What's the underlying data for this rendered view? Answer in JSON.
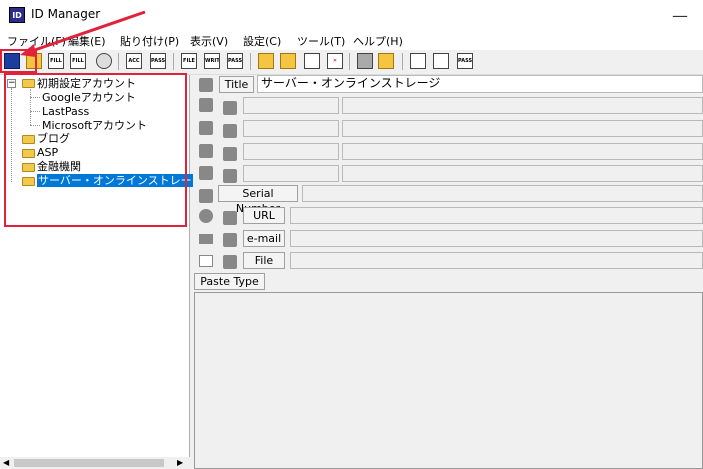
{
  "window": {
    "title": "ID Manager",
    "app_icon_text": "ID"
  },
  "menu": [
    "ファイル(F)",
    "編集(E)",
    "貼り付け(P)",
    "表示(V)",
    "設定(C)",
    "ツール(T)",
    "ヘルプ(H)"
  ],
  "toolbar": [
    {
      "name": "save-icon",
      "text": ""
    },
    {
      "name": "folder-open-icon",
      "text": ""
    },
    {
      "name": "fill-icon",
      "text": "FILL"
    },
    {
      "name": "fill-icon-2",
      "text": "FILL"
    },
    {
      "name": "pass-lock-icon",
      "text": ""
    },
    {
      "name": "printer-icon",
      "text": ""
    },
    {
      "name": "acc-icon",
      "text": "ACC"
    },
    {
      "name": "pass-icon",
      "text": "PASS"
    },
    {
      "name": "file-icon",
      "text": "FILE"
    },
    {
      "name": "write-icon",
      "text": "WRITE"
    },
    {
      "name": "pass-write-icon",
      "text": "PASS"
    },
    {
      "name": "new-folder-icon",
      "text": ""
    },
    {
      "name": "folder-add-icon",
      "text": ""
    },
    {
      "name": "new-document-icon",
      "text": ""
    },
    {
      "name": "delete-icon",
      "text": ""
    },
    {
      "name": "mp-icon",
      "text": ""
    },
    {
      "name": "swap-icon",
      "text": ""
    },
    {
      "name": "window-up-icon",
      "text": ""
    },
    {
      "name": "window-edit-icon",
      "text": ""
    },
    {
      "name": "pass-window-icon",
      "text": "PASS"
    }
  ],
  "tree": {
    "root": "初期設定アカウント",
    "children": [
      "Googleアカウント",
      "LastPass",
      "Microsoftアカウント"
    ],
    "folders": [
      "ブログ",
      "ASP",
      "金融機関",
      "サーバー・オンラインストレー"
    ],
    "selected": "サーバー・オンラインストレー"
  },
  "fields": {
    "title_label": "Title",
    "title_value": "サーバー・オンラインストレージ",
    "serial_label": "Serial Number",
    "url_label": "URL",
    "email_label": "e-mail",
    "file_label": "File",
    "paste_type_label": "Paste Type"
  },
  "colors": {
    "selection": "#0078d7",
    "annotation": "#e0223a"
  }
}
